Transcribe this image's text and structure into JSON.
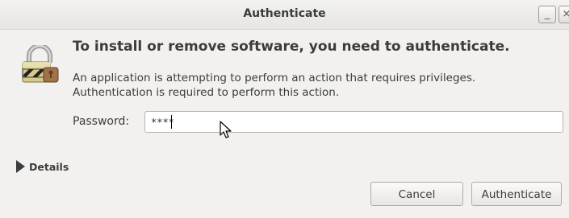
{
  "window": {
    "title": "Authenticate",
    "minimize_label": "_",
    "close_label": "×"
  },
  "dialog": {
    "heading": "To install or remove software, you need to authenticate.",
    "message_line1": "An application is attempting to perform an action that requires privileges.",
    "message_line2": "Authentication is required to perform this action.",
    "password_label": "Password:",
    "password_value": "****",
    "details_label": "Details"
  },
  "buttons": {
    "cancel": "Cancel",
    "authenticate": "Authenticate"
  },
  "icons": {
    "lock": "lock-icon",
    "expander": "triangle-right-icon",
    "pointer": "mouse-pointer-icon"
  }
}
